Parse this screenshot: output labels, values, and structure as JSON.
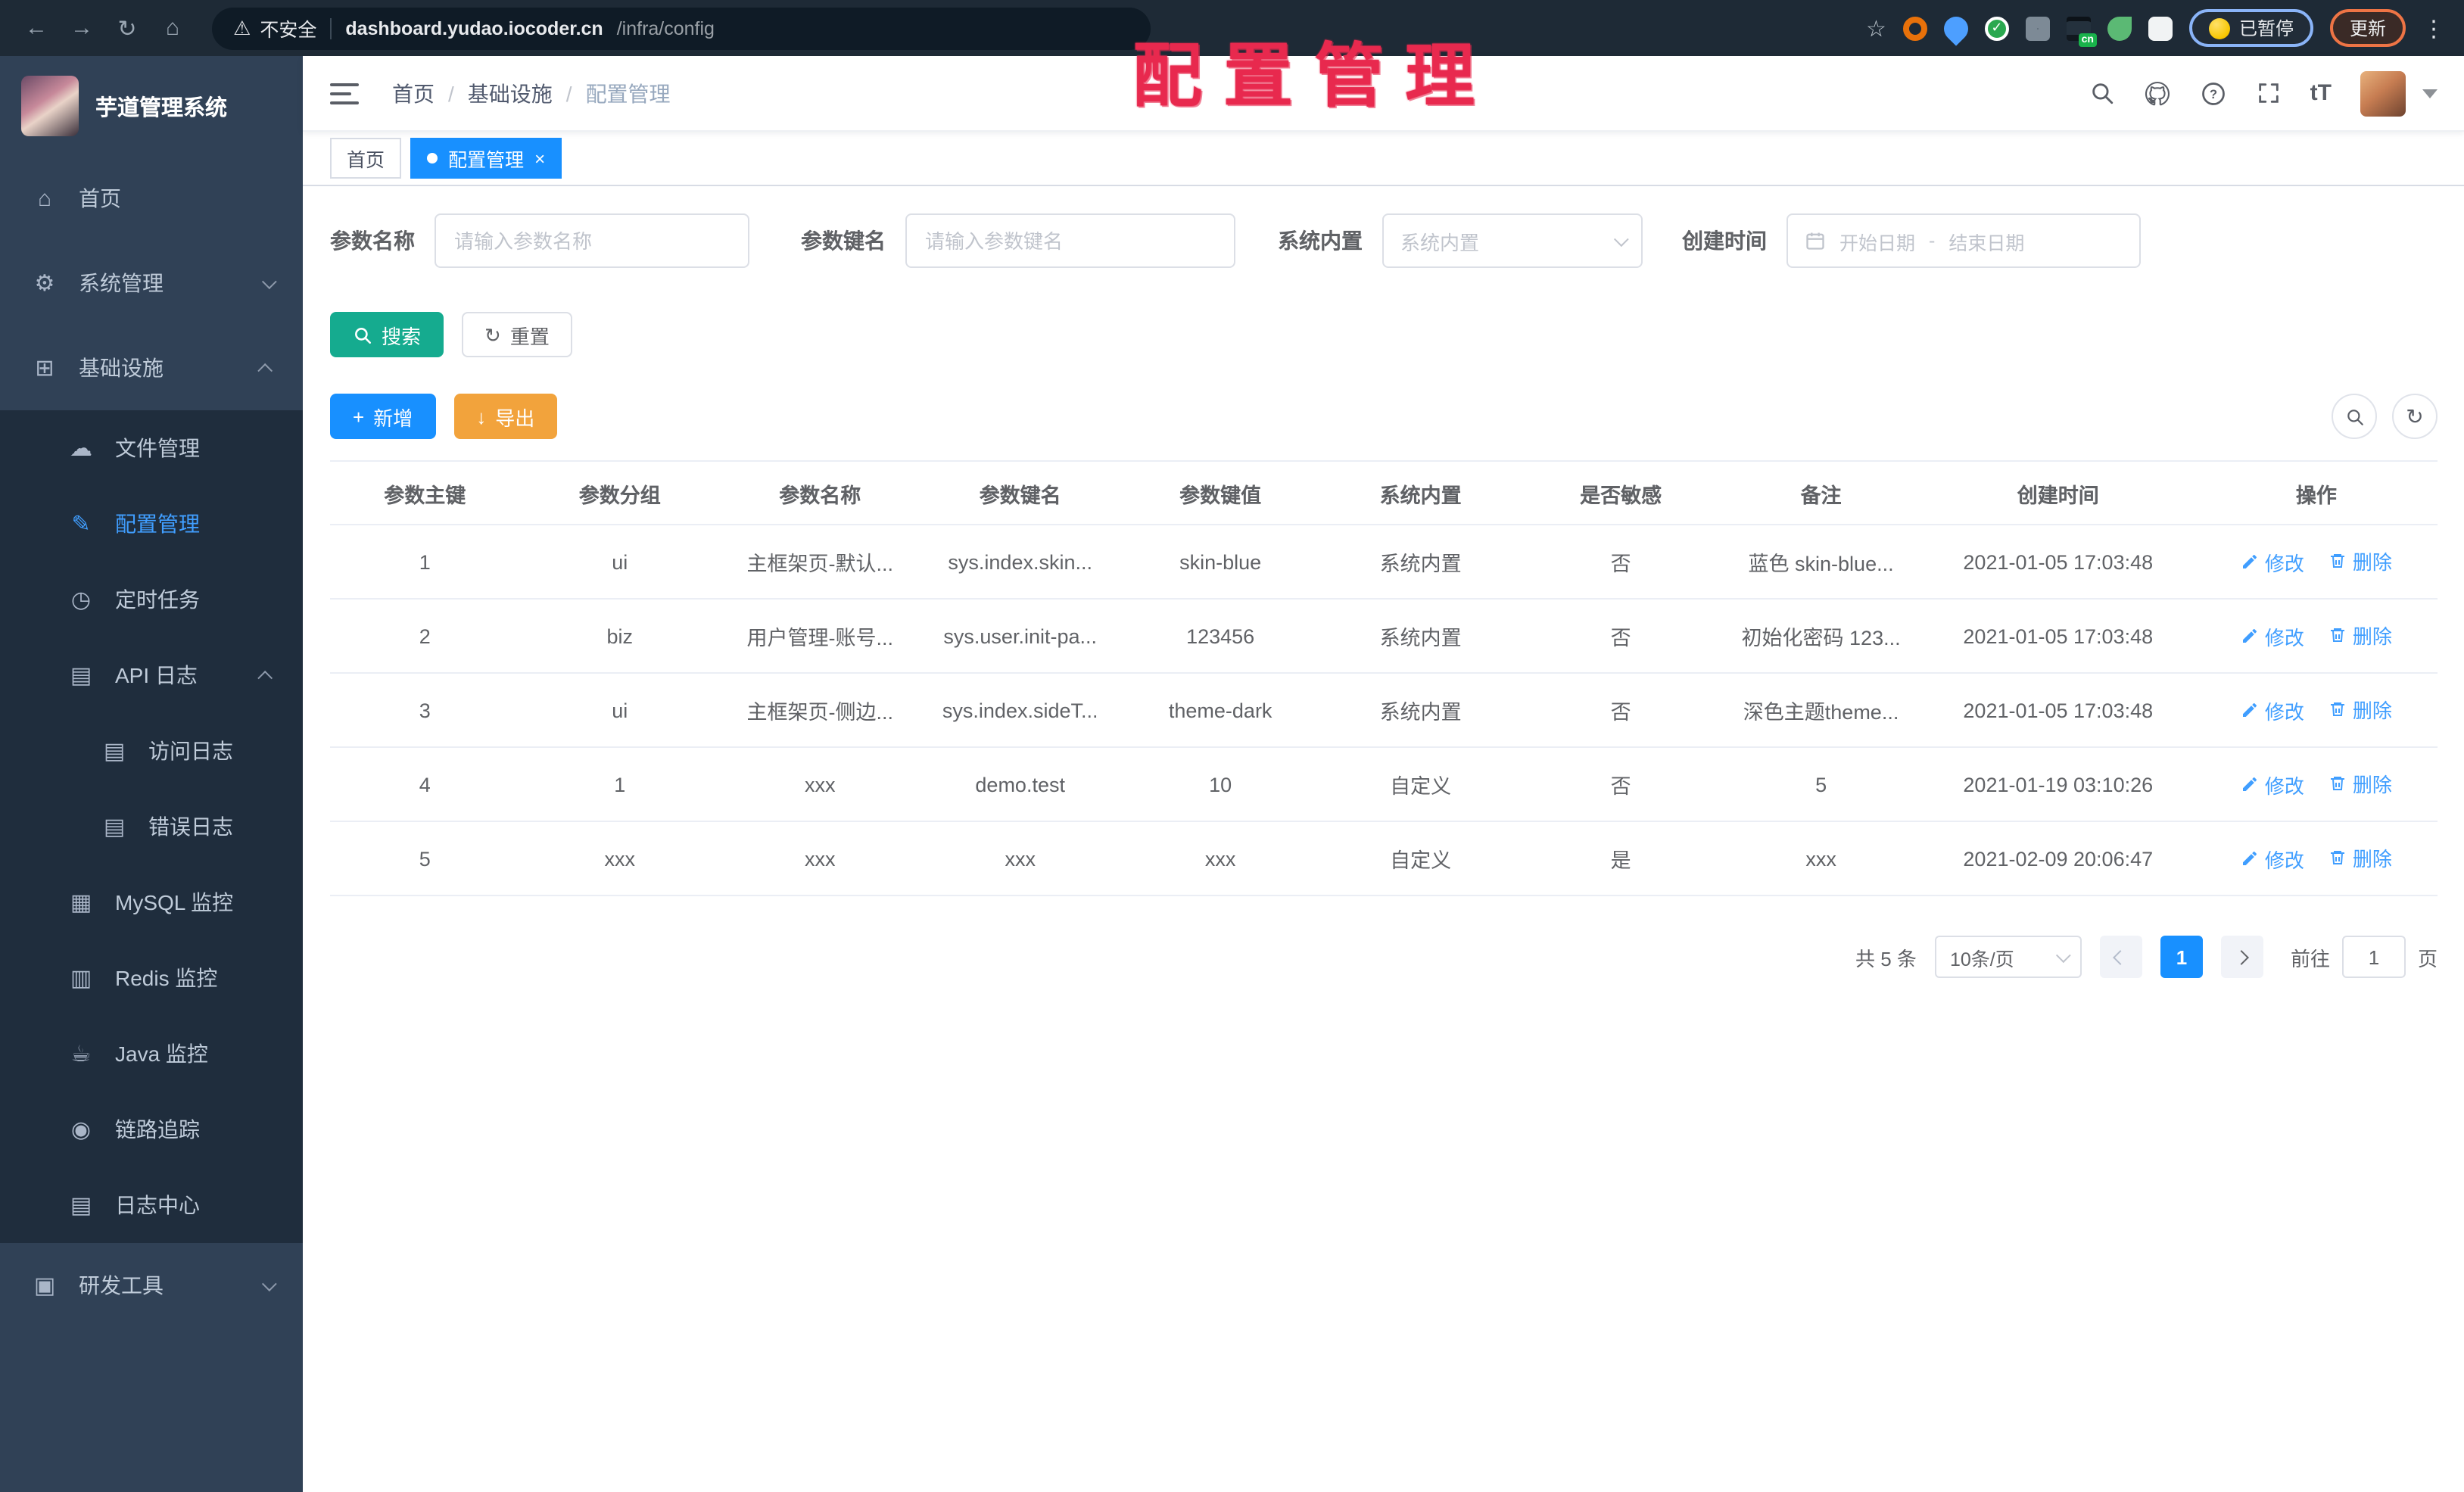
{
  "browser": {
    "security_label": "不安全",
    "url_host": "dashboard.yudao.iocoder.cn",
    "url_path": "/infra/config",
    "cn_badge": "cn",
    "paused_label": "已暂停",
    "update_label": "更新"
  },
  "overlay": {
    "title": "配置管理"
  },
  "icons": {
    "back": "←",
    "forward": "→",
    "reload": "↻",
    "home": "⌂",
    "warning": "⚠",
    "star": "☆",
    "overflow": "⋮",
    "check": "✓",
    "menu_home": "⌂",
    "menu_system": "⚙",
    "menu_infra": "⊞",
    "menu_file": "☁",
    "menu_config": "✎",
    "menu_job": "◷",
    "menu_api": "▤",
    "menu_access": "▤",
    "menu_error": "▤",
    "menu_mysql": "▦",
    "menu_redis": "▥",
    "menu_java": "☕",
    "menu_trace": "◉",
    "menu_logcenter": "▤",
    "menu_dev": "▣",
    "breadcrumb_sep": "/",
    "close": "×",
    "reset": "↻",
    "plus": "+",
    "download": "↓",
    "font_size": "tT"
  },
  "sidebar": {
    "app_title": "芋道管理系统",
    "home": "首页",
    "system": "系统管理",
    "infra": "基础设施",
    "file": "文件管理",
    "config": "配置管理",
    "job": "定时任务",
    "api_log": "API 日志",
    "access_log": "访问日志",
    "error_log": "错误日志",
    "mysql": "MySQL 监控",
    "redis": "Redis 监控",
    "java": "Java 监控",
    "trace": "链路追踪",
    "log_center": "日志中心",
    "dev_tools": "研发工具"
  },
  "breadcrumb": {
    "items": [
      "首页",
      "基础设施",
      "配置管理"
    ]
  },
  "tabs": {
    "home": "首页",
    "config": "配置管理"
  },
  "filters": {
    "name_label": "参数名称",
    "name_placeholder": "请输入参数名称",
    "key_label": "参数键名",
    "key_placeholder": "请输入参数键名",
    "builtin_label": "系统内置",
    "builtin_placeholder": "系统内置",
    "date_label": "创建时间",
    "date_start": "开始日期",
    "date_sep": "-",
    "date_end": "结束日期"
  },
  "actions": {
    "search": "搜索",
    "reset": "重置",
    "add": "新增",
    "export": "导出"
  },
  "table": {
    "columns": [
      "参数主键",
      "参数分组",
      "参数名称",
      "参数键名",
      "参数键值",
      "系统内置",
      "是否敏感",
      "备注",
      "创建时间",
      "操作"
    ],
    "ops": {
      "edit": "修改",
      "delete": "删除"
    },
    "rows": [
      {
        "id": "1",
        "group": "ui",
        "name": "主框架页-默认...",
        "key": "sys.index.skin...",
        "value": "skin-blue",
        "type": "系统内置",
        "sensitive": "否",
        "remark": "蓝色 skin-blue...",
        "created": "2021-01-05 17:03:48"
      },
      {
        "id": "2",
        "group": "biz",
        "name": "用户管理-账号...",
        "key": "sys.user.init-pa...",
        "value": "123456",
        "type": "系统内置",
        "sensitive": "否",
        "remark": "初始化密码 123...",
        "created": "2021-01-05 17:03:48"
      },
      {
        "id": "3",
        "group": "ui",
        "name": "主框架页-侧边...",
        "key": "sys.index.sideT...",
        "value": "theme-dark",
        "type": "系统内置",
        "sensitive": "否",
        "remark": "深色主题theme...",
        "created": "2021-01-05 17:03:48"
      },
      {
        "id": "4",
        "group": "1",
        "name": "xxx",
        "key": "demo.test",
        "value": "10",
        "type": "自定义",
        "sensitive": "否",
        "remark": "5",
        "created": "2021-01-19 03:10:26"
      },
      {
        "id": "5",
        "group": "xxx",
        "name": "xxx",
        "key": "xxx",
        "value": "xxx",
        "type": "自定义",
        "sensitive": "是",
        "remark": "xxx",
        "created": "2021-02-09 20:06:47"
      }
    ]
  },
  "pagination": {
    "total": "共 5 条",
    "page_size": "10条/页",
    "current": "1",
    "goto": "前往",
    "unit": "页",
    "goto_value": "1"
  },
  "colors": {
    "accent": "#1890ff",
    "link": "#409eff",
    "success": "#15ab8f",
    "warning": "#f2a33c",
    "overlay_red": "#e8294e",
    "sidebar_bg": "#304156",
    "submenu_bg": "#1f2d3d",
    "sidebar_text": "#bfcbd9"
  }
}
